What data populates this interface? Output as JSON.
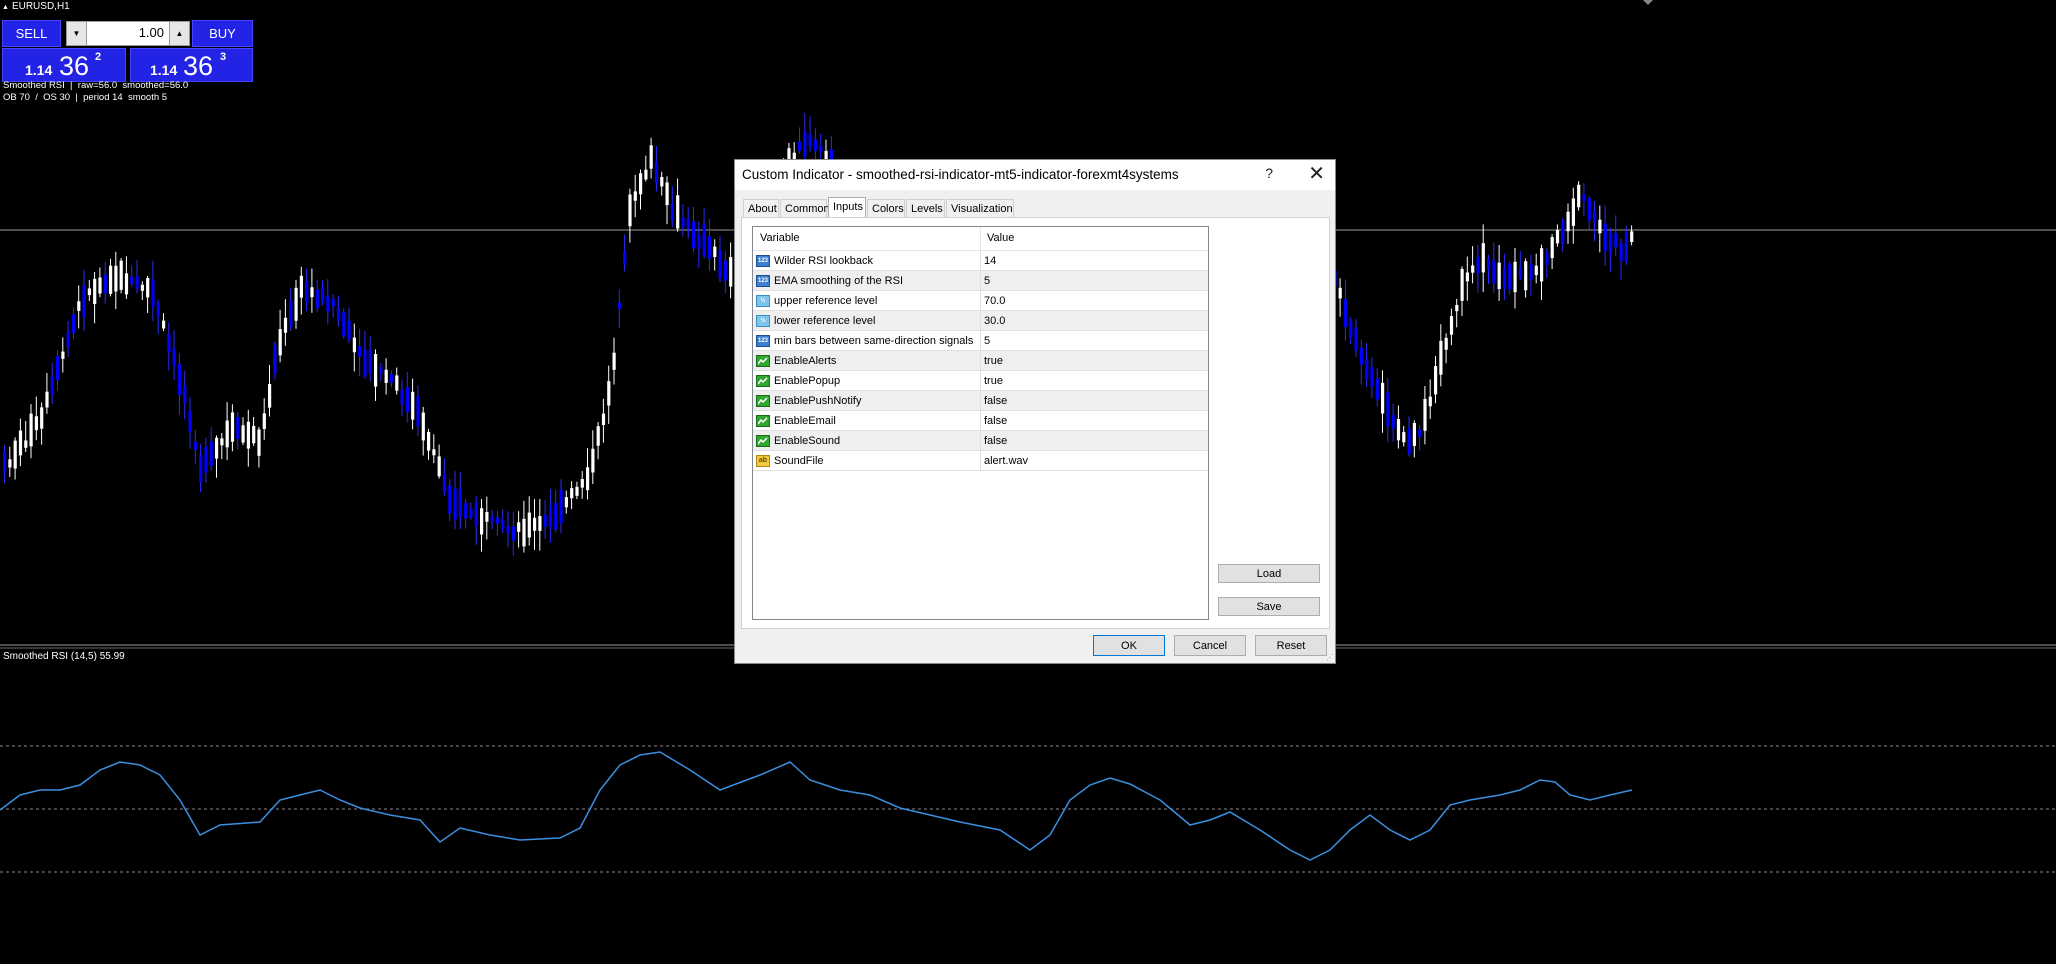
{
  "chart": {
    "symbol": "EURUSD,H1",
    "info_line_1": "Smoothed RSI  |  raw=56.0  smoothed=56.0",
    "info_line_2": "OB 70  /  OS 30  |  period 14  smooth 5",
    "subwindow_label": "Smoothed RSI (14,5) 55.99",
    "bull_color": "#ffffff",
    "bear_color": "#0000ff",
    "rsi_line_color": "#3b8fe0",
    "levels": [
      70,
      50,
      30
    ]
  },
  "trade_panel": {
    "sell_label": "SELL",
    "buy_label": "BUY",
    "lot": "1.00",
    "sell_price": {
      "prefix": "1.14",
      "big": "36",
      "sup": "2"
    },
    "buy_price": {
      "prefix": "1.14",
      "big": "36",
      "sup": "3"
    }
  },
  "dialog": {
    "title": "Custom Indicator - smoothed-rsi-indicator-mt5-indicator-forexmt4systems",
    "help": "?",
    "close": "✕",
    "tabs": [
      {
        "label": "About"
      },
      {
        "label": "Common"
      },
      {
        "label": "Inputs",
        "active": true
      },
      {
        "label": "Colors"
      },
      {
        "label": "Levels"
      },
      {
        "label": "Visualization"
      }
    ],
    "grid": {
      "header_variable": "Variable",
      "header_value": "Value",
      "rows": [
        {
          "icon": "int-icon",
          "icon_text": "123",
          "variable": "Wilder RSI lookback",
          "value": "14"
        },
        {
          "icon": "int-icon",
          "icon_text": "123",
          "variable": "EMA smoothing of the RSI",
          "value": "5"
        },
        {
          "icon": "double-icon",
          "icon_text": "½",
          "variable": "upper reference level",
          "value": "70.0"
        },
        {
          "icon": "double-icon",
          "icon_text": "½",
          "variable": "lower reference level",
          "value": "30.0"
        },
        {
          "icon": "int-icon",
          "icon_text": "123",
          "variable": "min bars between same-direction signals",
          "value": "5"
        },
        {
          "icon": "bool-icon",
          "icon_text": "",
          "variable": "EnableAlerts",
          "value": "true"
        },
        {
          "icon": "bool-icon",
          "icon_text": "",
          "variable": "EnablePopup",
          "value": "true"
        },
        {
          "icon": "bool-icon",
          "icon_text": "",
          "variable": "EnablePushNotify",
          "value": "false"
        },
        {
          "icon": "bool-icon",
          "icon_text": "",
          "variable": "EnableEmail",
          "value": "false"
        },
        {
          "icon": "bool-icon",
          "icon_text": "",
          "variable": "EnableSound",
          "value": "false"
        },
        {
          "icon": "string-icon",
          "icon_text": "ab",
          "variable": "SoundFile",
          "value": "alert.wav"
        }
      ]
    },
    "buttons": {
      "load": "Load",
      "save": "Save",
      "ok": "OK",
      "cancel": "Cancel",
      "reset": "Reset"
    }
  }
}
